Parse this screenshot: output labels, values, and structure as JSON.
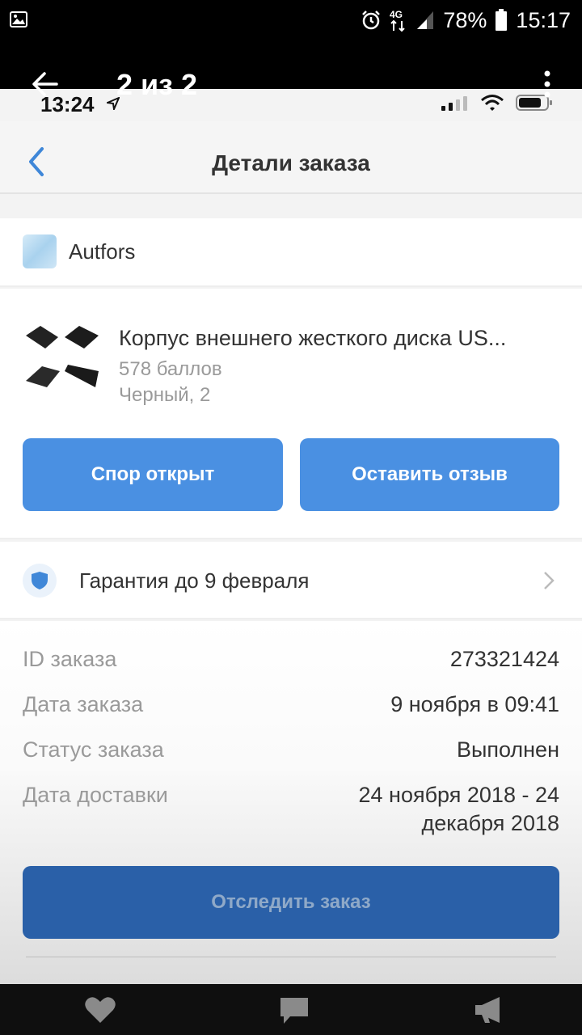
{
  "android_status": {
    "battery": "78%",
    "time": "15:17",
    "network": "4G",
    "icons": [
      "gallery-icon",
      "alarm-icon",
      "network-4g-icon",
      "signal-icon",
      "battery-icon"
    ]
  },
  "gallery": {
    "counter": "2 из 2",
    "icons": [
      "back-arrow-icon",
      "more-vertical-icon"
    ]
  },
  "ios_status": {
    "time": "13:24",
    "icons": [
      "location-arrow-icon",
      "cellular-signal-icon",
      "wifi-icon",
      "battery-icon"
    ]
  },
  "nav": {
    "title": "Детали заказа",
    "back_icon": "chevron-left-icon"
  },
  "seller": {
    "name": "Autfors"
  },
  "product": {
    "title": "Корпус внешнего жесткого диска US...",
    "points": "578 баллов",
    "variant": "Черный, 2"
  },
  "actions": {
    "dispute_label": "Спор открыт",
    "review_label": "Оставить отзыв"
  },
  "warranty": {
    "label": "Гарантия до 9 февраля",
    "icon": "shield-icon"
  },
  "order_details": {
    "rows": [
      {
        "key": "ID заказа",
        "value": "273321424"
      },
      {
        "key": "Дата заказа",
        "value": "9 ноября в 09:41"
      },
      {
        "key": "Статус заказа",
        "value": "Выполнен"
      },
      {
        "key": "Дата доставки",
        "value": "24 ноября 2018 - 24 декабря 2018"
      }
    ],
    "track_label": "Отследить заказ"
  },
  "bottom_bar": {
    "icons": [
      "heart-icon",
      "comment-icon",
      "megaphone-icon"
    ]
  },
  "colors": {
    "accent": "#4a90e2",
    "track_button": "#2a60a8"
  }
}
